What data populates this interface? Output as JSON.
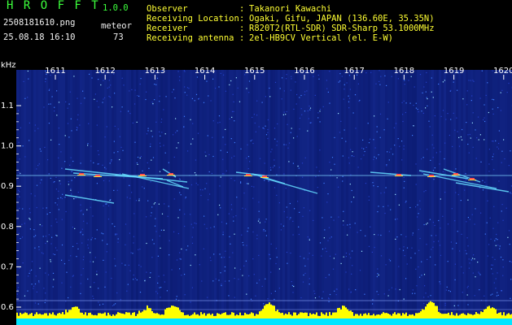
{
  "app": {
    "title": "H R O F F T",
    "version": "1.0.0",
    "filename": "2508181610.png",
    "timestamp": "25.08.18 16:10",
    "mode_label": "meteor",
    "count": "73"
  },
  "info": [
    {
      "label": "Observer",
      "value": "Takanori Kawachi"
    },
    {
      "label": "Receiving Location",
      "value": "Ogaki, Gifu, JAPAN (136.60E, 35.35N)"
    },
    {
      "label": "Receiver",
      "value": "R820T2(RTL-SDR) SDR-Sharp 53.1000MHz"
    },
    {
      "label": "Receiving antenna",
      "value": "2el-HB9CV Vertical (el. E-W)"
    }
  ],
  "axis": {
    "y_unit": "kHz",
    "y_ticks": [
      "1.1",
      "1.0",
      "0.9",
      "0.8",
      "0.7",
      "0.6"
    ],
    "x_ticks": [
      "1611",
      "1612",
      "1613",
      "1614",
      "1615",
      "1616",
      "1617",
      "1618",
      "1619",
      "1620"
    ]
  },
  "colors": {
    "background": "#000000",
    "spectrum_base": "#0a1a6e",
    "header_green": "#3cff3c",
    "header_yellow": "#ffff33",
    "signal": "#66ddff",
    "meter_yellow": "#ffff00",
    "meter_cyan": "#00e5ff"
  }
}
